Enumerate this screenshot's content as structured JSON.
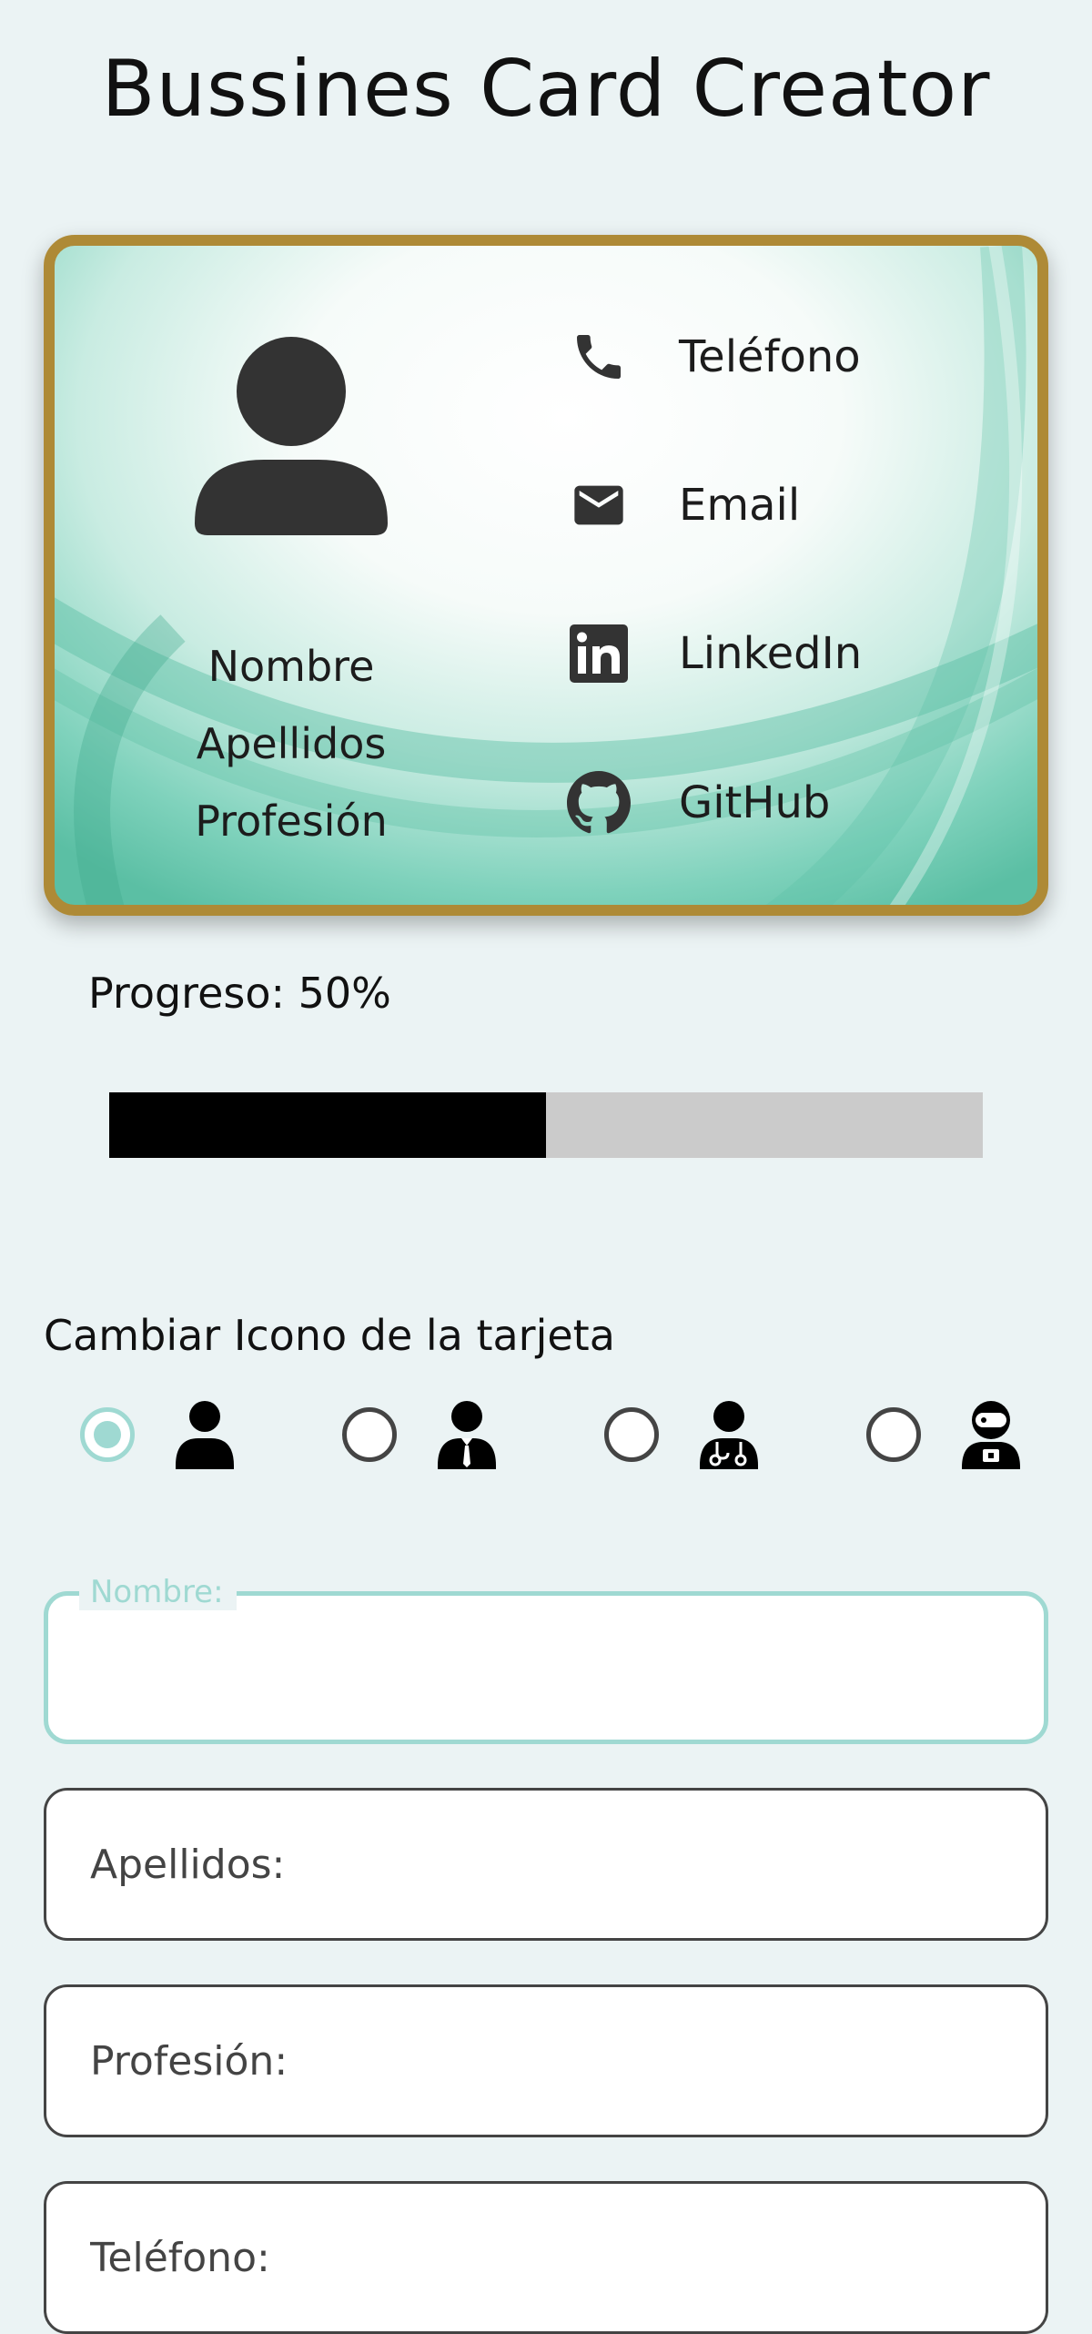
{
  "page": {
    "title": "Bussines Card Creator"
  },
  "card": {
    "name": "Nombre",
    "surname": "Apellidos",
    "profession": "Profesión",
    "contacts": [
      {
        "icon": "phone-icon",
        "label": "Teléfono"
      },
      {
        "icon": "email-icon",
        "label": "Email"
      },
      {
        "icon": "linkedin-icon",
        "label": "LinkedIn"
      },
      {
        "icon": "github-icon",
        "label": "GitHub"
      }
    ],
    "colors": {
      "border": "#ae8a36",
      "accent": "#5bbfa4"
    }
  },
  "progress": {
    "label": "Progreso: 50%",
    "value": 0.5
  },
  "icon_picker": {
    "title": "Cambiar Icono de la tarjeta",
    "options": [
      {
        "icon": "person-icon",
        "selected": true
      },
      {
        "icon": "businessman-icon",
        "selected": false
      },
      {
        "icon": "doctor-icon",
        "selected": false
      },
      {
        "icon": "astronaut-icon",
        "selected": false
      }
    ]
  },
  "form": {
    "name": {
      "label": "Nombre:",
      "value": ""
    },
    "surname": {
      "placeholder": "Apellidos:",
      "value": ""
    },
    "profession": {
      "placeholder": "Profesión:",
      "value": ""
    },
    "phone": {
      "placeholder": "Teléfono:",
      "value": ""
    }
  },
  "colors": {
    "background": "#ebf3f4",
    "focus": "#9fd9d2",
    "progress_fill": "#000000",
    "progress_track": "#cbcbcb"
  }
}
